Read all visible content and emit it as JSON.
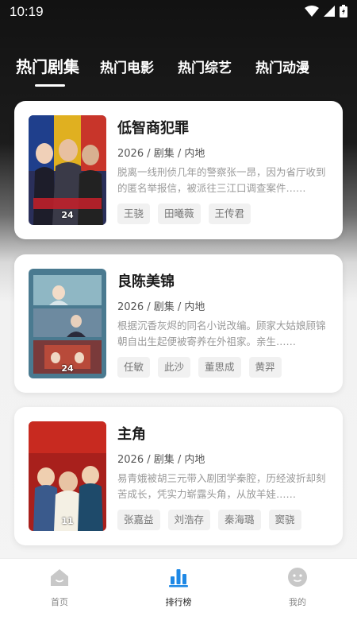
{
  "status": {
    "time": "10:19"
  },
  "tabs": [
    "热门剧集",
    "热门电影",
    "热门综艺",
    "热门动漫"
  ],
  "cards": [
    {
      "title": "低智商犯罪",
      "meta": "2026 / 剧集 / 内地",
      "desc": "脱离一线刑侦几年的警察张一昂，因为省厅收到的匿名举报信，被派往三江口调查案件……",
      "tags": [
        "王骁",
        "田曦薇",
        "王传君"
      ],
      "poster_badge": "24"
    },
    {
      "title": "良陈美锦",
      "meta": "2026 / 剧集 / 内地",
      "desc": "根据沉香灰烬的同名小说改编。顾家大姑娘顾锦朝自出生起便被寄养在外祖家。亲生……",
      "tags": [
        "任敏",
        "此沙",
        "董思成",
        "黄羿"
      ],
      "poster_badge": "24"
    },
    {
      "title": "主角",
      "meta": "2026 / 剧集 / 内地",
      "desc": "易青娥被胡三元带入剧团学秦腔，历经波折却刻苦成长，凭实力崭露头角，从放羊娃……",
      "tags": [
        "张嘉益",
        "刘浩存",
        "秦海璐",
        "窦骁"
      ],
      "poster_badge": "11"
    }
  ],
  "bottom_nav": [
    {
      "label": "首页",
      "icon": "home-icon"
    },
    {
      "label": "排行榜",
      "icon": "ranking-icon"
    },
    {
      "label": "我的",
      "icon": "profile-icon"
    }
  ],
  "colors": {
    "accent": "#1e88e5",
    "nav_inactive": "#c8c8c8"
  }
}
